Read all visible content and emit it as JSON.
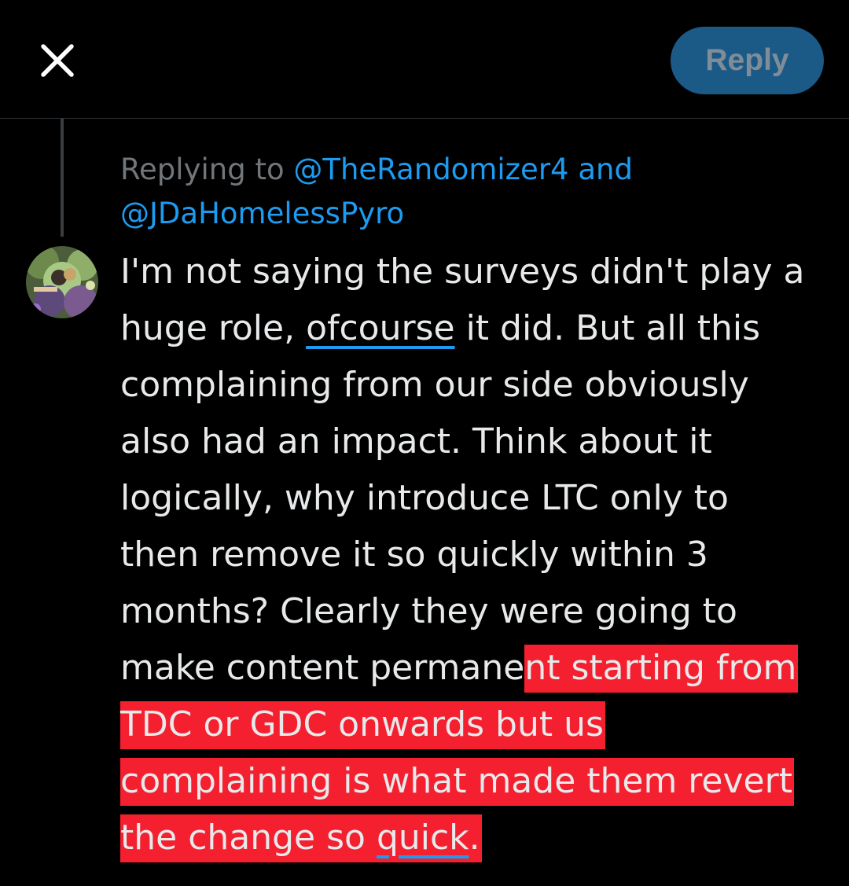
{
  "header": {
    "reply_label": "Reply",
    "accent_color": "#1d9bf0",
    "reply_button_color": "#1b5a87"
  },
  "replying": {
    "prefix": "Replying to ",
    "mention_1": "@TheRandomizer4",
    "conjunction": " and",
    "mention_2": "@JDaHomelessPyro"
  },
  "tweet": {
    "line_1": "I'm not saying the surveys didn't play a",
    "line_2_a": "huge role, ",
    "line_2_link": "ofcourse",
    "line_2_b": " it did. But all this",
    "line_3": "complaining from our side obviously",
    "line_4": "also had an impact. Think about it",
    "line_5": "logically, why introduce LTC only to",
    "line_6": "then remove it so quickly within 3",
    "line_7": "months? Clearly they were going to",
    "line_8_a": "make content permane",
    "line_8_hl": "nt starting from",
    "line_9": "TDC or GDC onwards but us",
    "line_10": "complaining is what made them revert",
    "line_11_a": "the change so ",
    "line_11_link": "quick",
    "line_11_b": ".",
    "highlight_color": "#f4202f"
  },
  "icons": {
    "close": "close-icon",
    "avatar": "avatar"
  }
}
